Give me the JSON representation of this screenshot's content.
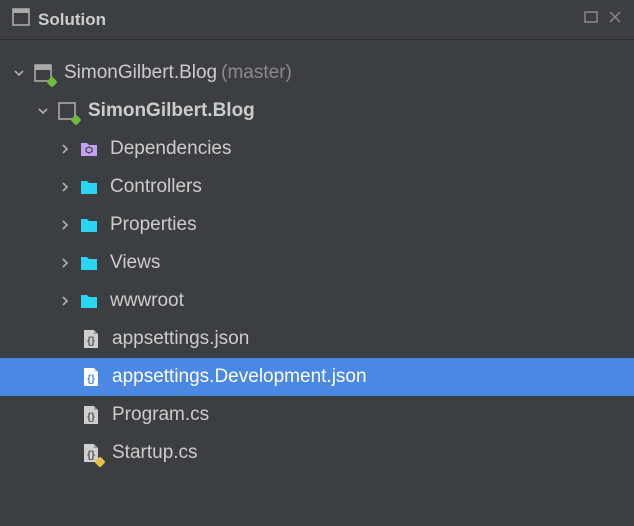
{
  "header": {
    "title": "Solution"
  },
  "tree": {
    "root": {
      "label": "SimonGilbert.Blog",
      "branch": "(master)"
    },
    "project": {
      "label": "SimonGilbert.Blog"
    },
    "items": [
      {
        "label": "Dependencies",
        "icon": "hexagon",
        "expandable": true
      },
      {
        "label": "Controllers",
        "icon": "folder",
        "expandable": true
      },
      {
        "label": "Properties",
        "icon": "folder",
        "expandable": true
      },
      {
        "label": "Views",
        "icon": "folder",
        "expandable": true
      },
      {
        "label": "wwwroot",
        "icon": "folder",
        "expandable": true
      },
      {
        "label": "appsettings.json",
        "icon": "jsonfile",
        "expandable": false,
        "selected": false
      },
      {
        "label": "appsettings.Development.json",
        "icon": "jsonfile",
        "expandable": false,
        "selected": true
      },
      {
        "label": "Program.cs",
        "icon": "jsonfile",
        "expandable": false,
        "selected": false
      },
      {
        "label": "Startup.cs",
        "icon": "jsonfile",
        "expandable": false,
        "selected": false,
        "vcs": "yellow"
      }
    ]
  }
}
